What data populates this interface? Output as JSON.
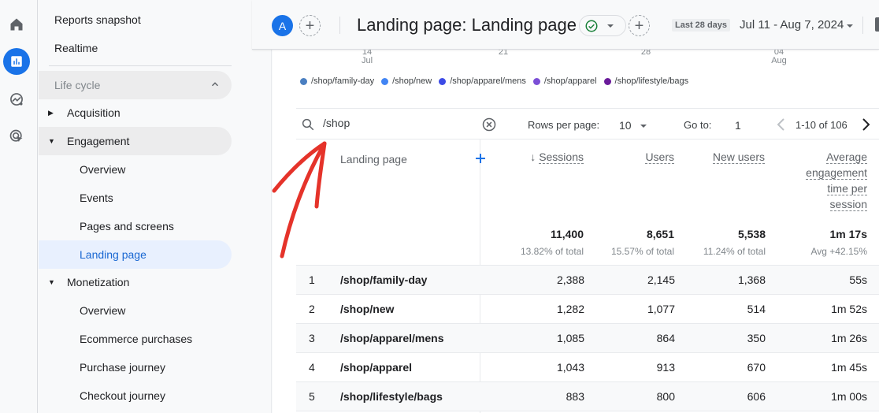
{
  "rail": {
    "items": [
      {
        "name": "home",
        "icon": "home-icon"
      },
      {
        "name": "reports",
        "icon": "bar-chart-icon",
        "active": true
      },
      {
        "name": "explore",
        "icon": "explore-icon"
      },
      {
        "name": "advertising",
        "icon": "advertising-icon"
      }
    ]
  },
  "nav": {
    "reports_snapshot": "Reports snapshot",
    "realtime": "Realtime",
    "life_cycle": "Life cycle",
    "acquisition": "Acquisition",
    "engagement": "Engagement",
    "engagement_items": [
      "Overview",
      "Events",
      "Pages and screens",
      "Landing page"
    ],
    "monetization": "Monetization",
    "monetization_items": [
      "Overview",
      "Ecommerce purchases",
      "Purchase journey",
      "Checkout journey"
    ]
  },
  "header": {
    "avatar_letter": "A",
    "title": "Landing page: Landing page",
    "date_chip": "Last 28 days",
    "date_range": "Jul 11 - Aug 7, 2024"
  },
  "chart": {
    "axis_ticks": [
      {
        "day": "14",
        "month": "Jul"
      },
      {
        "day": "21",
        "month": ""
      },
      {
        "day": "28",
        "month": ""
      },
      {
        "day": "04",
        "month": "Aug"
      }
    ],
    "legend": [
      {
        "label": "/shop/family-day",
        "color": "#4a7fc1"
      },
      {
        "label": "/shop/new",
        "color": "#4285f4"
      },
      {
        "label": "/shop/apparel/mens",
        "color": "#3d4be6"
      },
      {
        "label": "/shop/apparel",
        "color": "#7b4fd6"
      },
      {
        "label": "/shop/lifestyle/bags",
        "color": "#6a1b9a"
      }
    ]
  },
  "toolbar": {
    "search_value": "/shop",
    "rows_per_page_label": "Rows per page:",
    "rows_per_page_value": "10",
    "goto_label": "Go to:",
    "goto_value": "1",
    "pagination": "1-10 of 106"
  },
  "table": {
    "dimension_header": "Landing page",
    "columns": [
      {
        "label": "Sessions",
        "sorted": true,
        "total": "11,400",
        "sub": "13.82% of total"
      },
      {
        "label": "Users",
        "total": "8,651",
        "sub": "15.57% of total"
      },
      {
        "label": "New users",
        "total": "5,538",
        "sub": "11.24% of total"
      },
      {
        "label_lines": [
          "Average",
          "engagement",
          "time per",
          "session"
        ],
        "total": "1m 17s",
        "sub": "Avg +42.15%"
      }
    ],
    "rows": [
      {
        "rank": "1",
        "page": "/shop/family-day",
        "sessions": "2,388",
        "users": "2,145",
        "new_users": "1,368",
        "avg_time": "55s"
      },
      {
        "rank": "2",
        "page": "/shop/new",
        "sessions": "1,282",
        "users": "1,077",
        "new_users": "514",
        "avg_time": "1m 52s"
      },
      {
        "rank": "3",
        "page": "/shop/apparel/mens",
        "sessions": "1,085",
        "users": "864",
        "new_users": "350",
        "avg_time": "1m 26s"
      },
      {
        "rank": "4",
        "page": "/shop/apparel",
        "sessions": "1,043",
        "users": "913",
        "new_users": "670",
        "avg_time": "1m 45s"
      },
      {
        "rank": "5",
        "page": "/shop/lifestyle/bags",
        "sessions": "883",
        "users": "800",
        "new_users": "606",
        "avg_time": "1m 00s"
      }
    ]
  },
  "colors": {
    "accent": "#1a73e8",
    "annotation_arrow": "#e5332a",
    "status_ok": "#188038"
  }
}
